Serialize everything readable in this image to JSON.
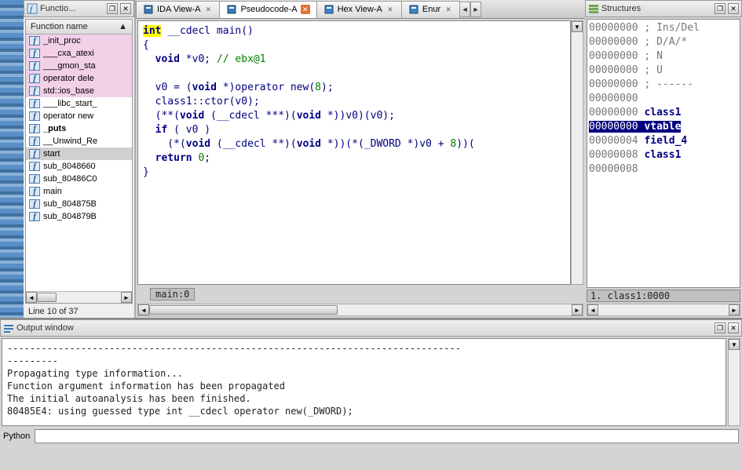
{
  "functions_panel": {
    "title": "Functio...",
    "header": "Function name",
    "items": [
      {
        "label": "_init_proc"
      },
      {
        "label": "___cxa_atexi"
      },
      {
        "label": "___gmon_sta"
      },
      {
        "label": "operator dele"
      },
      {
        "label": "std::ios_base"
      },
      {
        "label": "___libc_start_"
      },
      {
        "label": "operator new"
      },
      {
        "label": "_puts"
      },
      {
        "label": "__Unwind_Re"
      },
      {
        "label": "start"
      },
      {
        "label": "sub_8048660"
      },
      {
        "label": "sub_80486C0"
      },
      {
        "label": "main"
      },
      {
        "label": "sub_804875B"
      },
      {
        "label": "sub_804879B"
      }
    ],
    "status": "Line 10 of 37"
  },
  "tabs": [
    {
      "label": "IDA View-A",
      "icon": "ida"
    },
    {
      "label": "Pseudocode-A",
      "icon": "pseudo",
      "active": true,
      "close_orange": true
    },
    {
      "label": "Hex View-A",
      "icon": "hex"
    },
    {
      "label": "Enur",
      "icon": "enum"
    }
  ],
  "code_footer": "main:0",
  "code": {
    "l1_int": "int",
    "l1_rest": " __cdecl main()",
    "l4_a": "  v0",
    "l4_b": " = (",
    "l4_c": "void",
    "l4_d": " *)operator new(",
    "l4_e": "8",
    "l4_f": ");",
    "l5_a": "  class1::ctor(",
    "l5_b": "v0",
    "l5_c": ");",
    "l6_a": "  (**(",
    "l6_b": "void",
    "l6_c": " (__cdecl ***)(",
    "l6_d": "void",
    "l6_e": " *))",
    "l6_f": "v0",
    "l6_g": ")(",
    "l6_h": "v0",
    "l6_i": ");",
    "l7_a": "if",
    "l7_b": " ( ",
    "l7_c": "v0",
    "l7_d": " )",
    "l8_a": "    (*(",
    "l8_b": "void",
    "l8_c": " (__cdecl **)(",
    "l8_d": "void",
    "l8_e": " *))(*(_DWORD *)",
    "l8_f": "v0",
    "l8_g": " + ",
    "l8_h": "8",
    "l8_i": "))(",
    "l9_a": "return",
    "l9_b": "0",
    "l3_a": "void",
    "l3_b": " *",
    "l3_c": "v0",
    "l3_d": "; ",
    "l3_e": "// ebx@1"
  },
  "structures": {
    "title": "Structures",
    "lines": [
      {
        "addr": "00000000",
        "text": "; Ins/Del"
      },
      {
        "addr": "00000000",
        "text": "; D/A/*"
      },
      {
        "addr": "00000000",
        "text": "; N"
      },
      {
        "addr": "00000000",
        "text": "; U"
      },
      {
        "addr": "00000000",
        "text": "; ------"
      },
      {
        "addr": "00000000",
        "text": ""
      },
      {
        "addr": "00000000",
        "text": "class1"
      },
      {
        "addr": "00000000",
        "text": "vtable"
      },
      {
        "addr": "00000004",
        "text": "field_4"
      },
      {
        "addr": "00000008",
        "text": "class1"
      },
      {
        "addr": "00000008",
        "text": ""
      }
    ],
    "footer": "1. class1:0000"
  },
  "output": {
    "title": "Output window",
    "lines": [
      "---------",
      "Propagating type information...",
      "Function argument information has been propagated",
      "The initial autoanalysis has been finished.",
      "80485E4: using guessed type int __cdecl operator new(_DWORD);"
    ]
  },
  "python_label": "Python"
}
